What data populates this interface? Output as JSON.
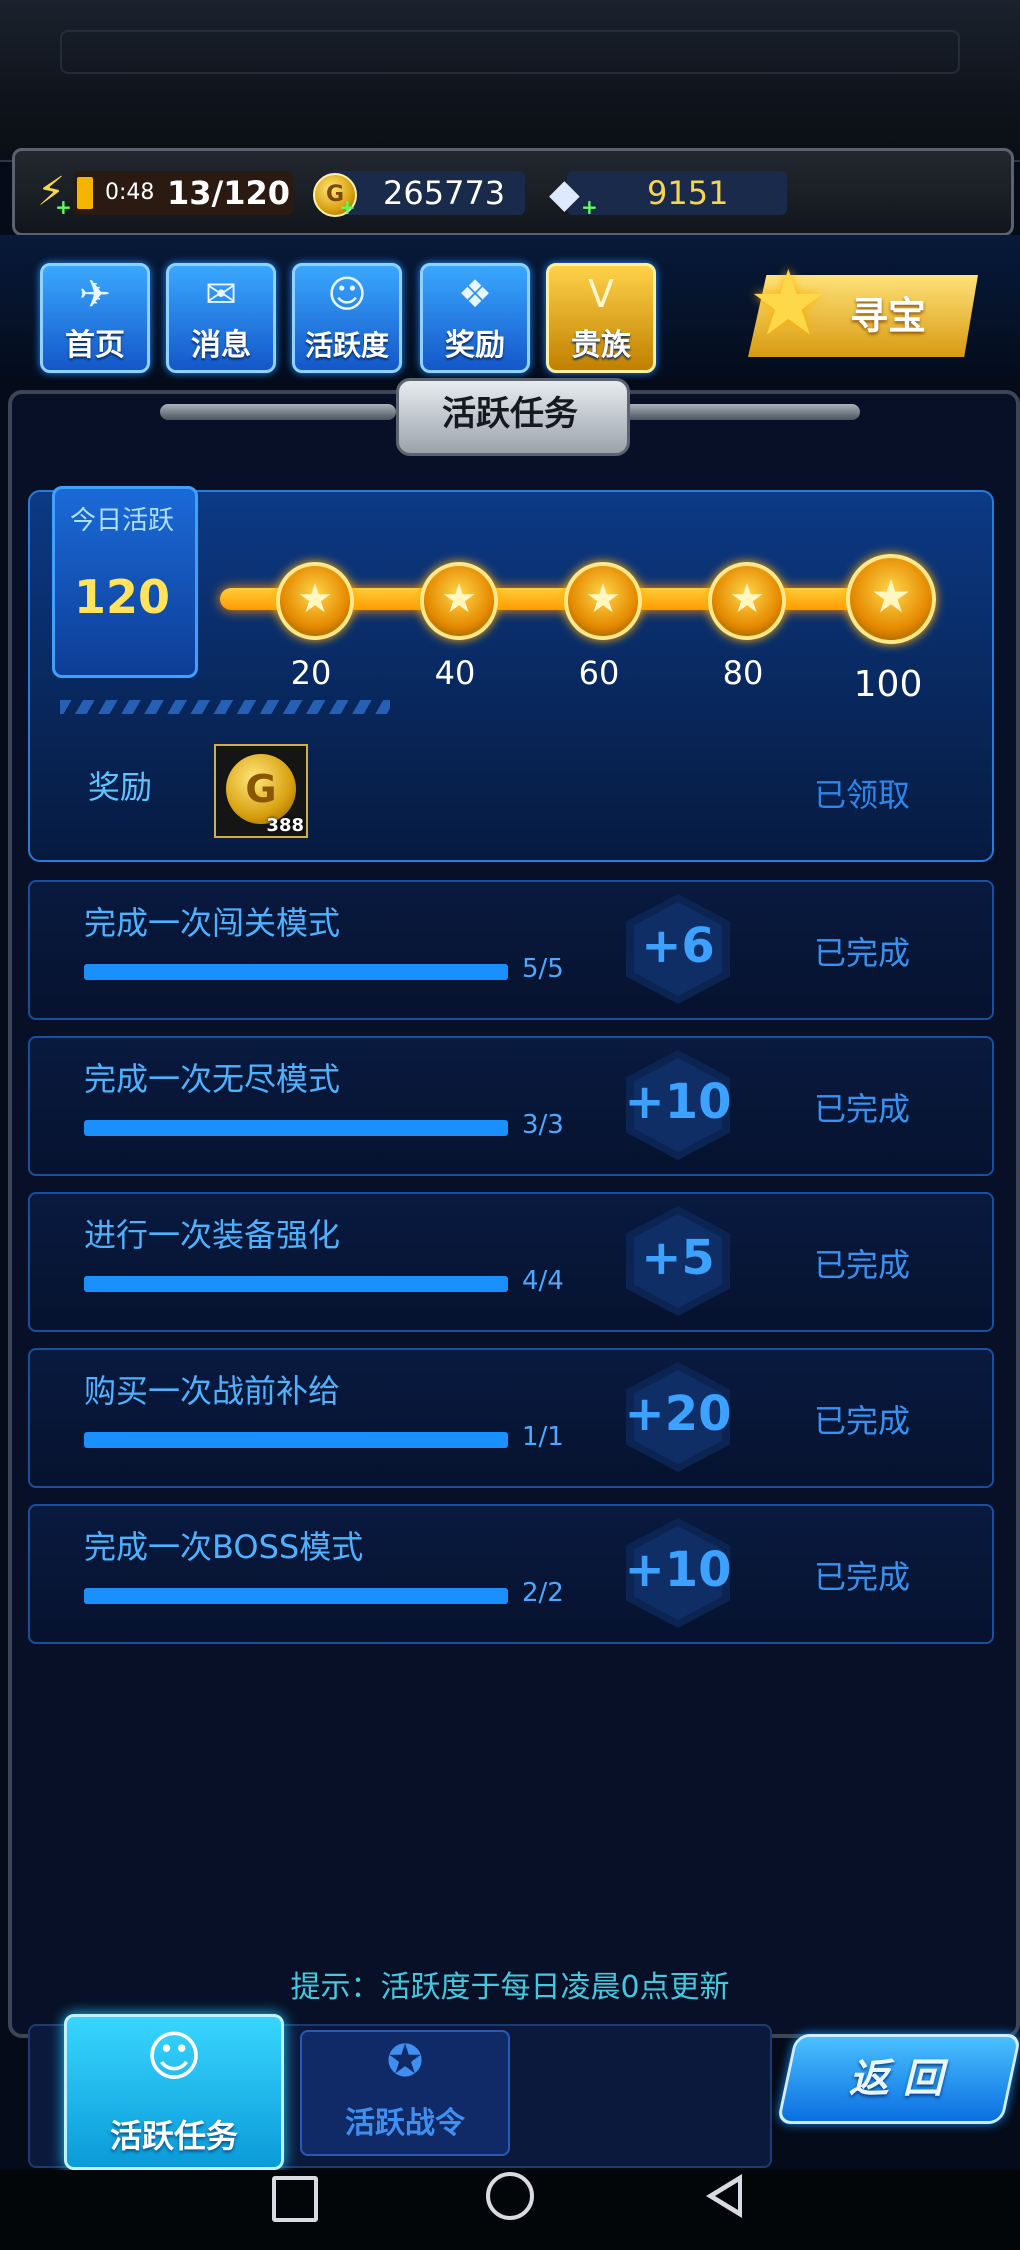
{
  "resources": {
    "energy_timer": "0:48",
    "energy": "13/120",
    "gold": "265773",
    "gems": "9151"
  },
  "nav": {
    "items": [
      {
        "label": "首页",
        "icon": "fighter-jet-icon"
      },
      {
        "label": "消息",
        "icon": "mail-icon"
      },
      {
        "label": "活跃度",
        "icon": "smile-badge-icon"
      },
      {
        "label": "奖励",
        "icon": "gift-icon"
      },
      {
        "label": "贵族",
        "icon": "vip-icon"
      }
    ],
    "treasure_label": "寻宝"
  },
  "panel": {
    "title": "活跃任务"
  },
  "activity": {
    "today_label": "今日活跃",
    "today_value": "120",
    "milestones": [
      "20",
      "40",
      "60",
      "80",
      "100"
    ],
    "progress_fraction": 1.0,
    "reward_label": "奖励",
    "reward_item_amount": "388",
    "reward_status": "已领取"
  },
  "tasks": [
    {
      "name": "完成一次闯关模式",
      "progress": "5/5",
      "points": "+6",
      "status": "已完成",
      "fill": 1.0
    },
    {
      "name": "完成一次无尽模式",
      "progress": "3/3",
      "points": "+10",
      "status": "已完成",
      "fill": 1.0
    },
    {
      "name": "进行一次装备强化",
      "progress": "4/4",
      "points": "+5",
      "status": "已完成",
      "fill": 1.0
    },
    {
      "name": "购买一次战前补给",
      "progress": "1/1",
      "points": "+20",
      "status": "已完成",
      "fill": 1.0
    },
    {
      "name": "完成一次BOSS模式",
      "progress": "2/2",
      "points": "+10",
      "status": "已完成",
      "fill": 1.0
    }
  ],
  "hint": "提示：活跃度于每日凌晨0点更新",
  "tabs": [
    {
      "label": "活跃任务",
      "active": true
    },
    {
      "label": "活跃战令",
      "active": false
    }
  ],
  "back_label": "返 回",
  "colors": {
    "accent": "#1a90ff",
    "gold": "#ffce3a",
    "status_text": "#3a92f0",
    "background": "#050b18"
  }
}
